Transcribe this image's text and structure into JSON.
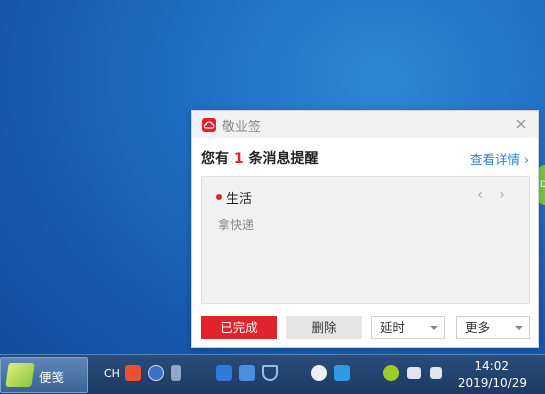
{
  "popup": {
    "app_name": "敬业签",
    "title_prefix": "您有",
    "count": "1",
    "title_suffix": "条消息提醒",
    "details_link": "查看详情",
    "card": {
      "category": "生活",
      "note": "拿快递"
    },
    "buttons": {
      "done": "已完成",
      "delete": "删除",
      "delay": "延时",
      "more": "更多"
    }
  },
  "taskbar": {
    "task_label": "便笺",
    "input_lang": "CH",
    "time": "14:02",
    "date": "2019/10/29"
  },
  "edge_widget": {
    "text": "D"
  },
  "colors": {
    "accent_red": "#e0232c",
    "link_blue": "#2c7fd2",
    "desktop_blue": "#1f6fc4"
  }
}
